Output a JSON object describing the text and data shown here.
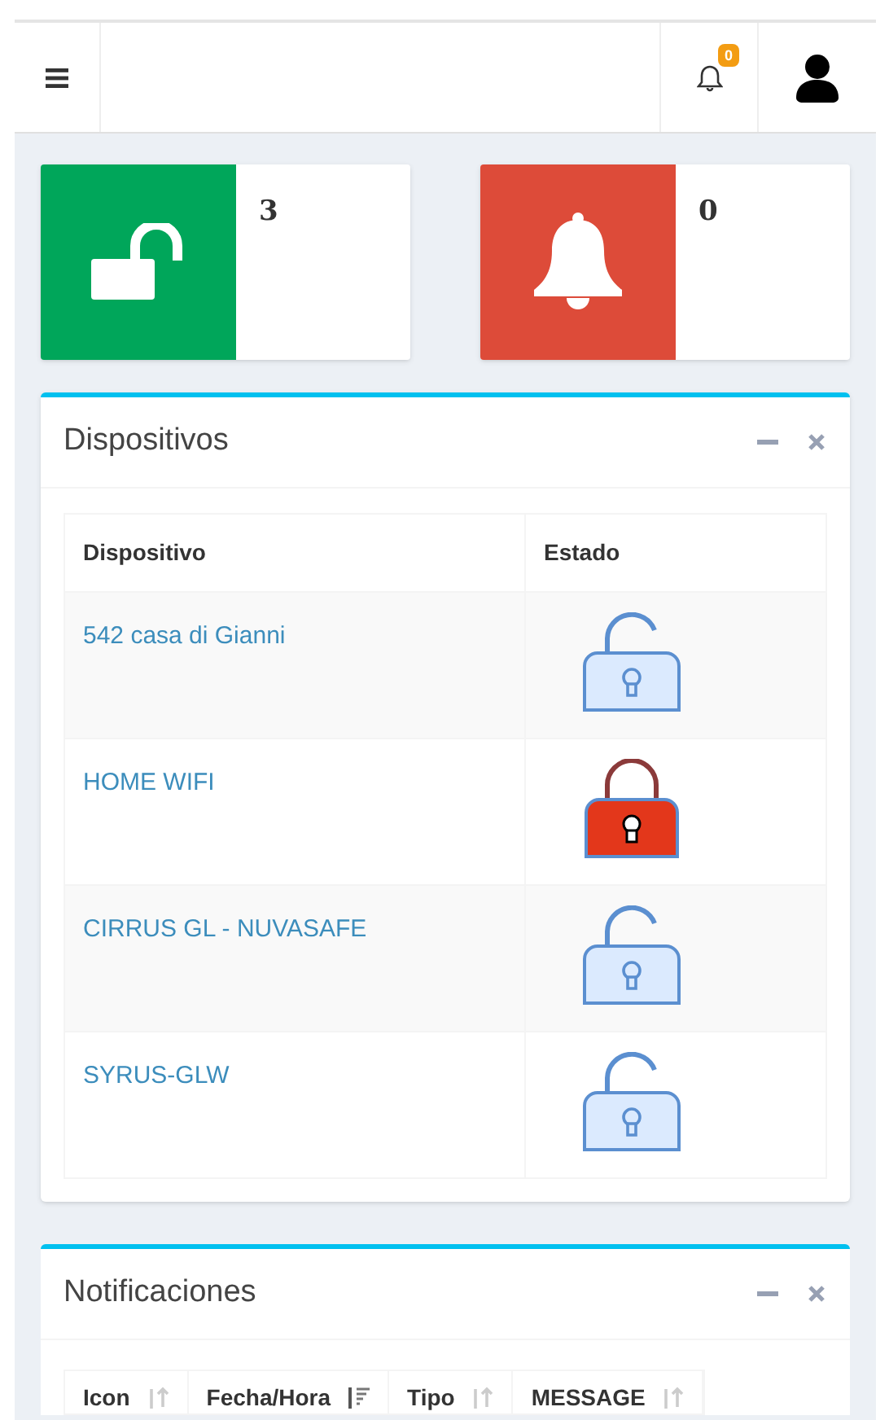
{
  "header": {
    "notifications_badge": "0"
  },
  "info_boxes": [
    {
      "kind": "unlocked",
      "color": "#00a65a",
      "number": "3"
    },
    {
      "kind": "alarm",
      "color": "#dd4b39",
      "number": "0"
    }
  ],
  "devices": {
    "title": "Dispositivos",
    "columns": [
      "Dispositivo",
      "Estado"
    ],
    "rows": [
      {
        "name": "542 casa di Gianni",
        "locked": false
      },
      {
        "name": "HOME WIFI",
        "locked": true
      },
      {
        "name": "CIRRUS GL - NUVASAFE",
        "locked": false
      },
      {
        "name": "SYRUS-GLW",
        "locked": false
      }
    ]
  },
  "notifications": {
    "title": "Notificaciones",
    "columns": [
      {
        "label": "Icon",
        "kind": "sortable"
      },
      {
        "label": "Fecha/Hora",
        "kind": "sorted"
      },
      {
        "label": "Tipo",
        "kind": "sortable"
      },
      {
        "label": "MESSAGE",
        "kind": "sortable"
      }
    ]
  }
}
